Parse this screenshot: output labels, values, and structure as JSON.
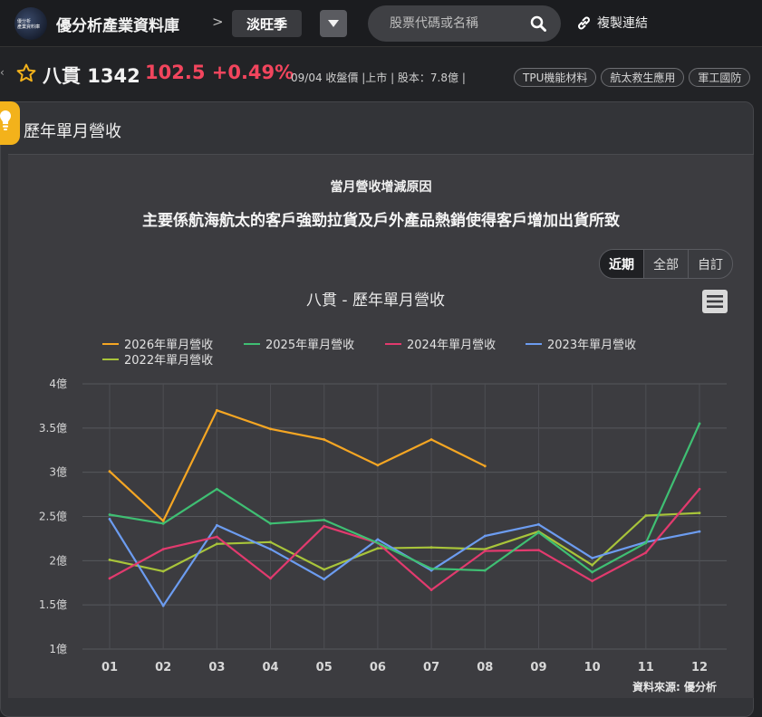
{
  "header": {
    "logo_text_1": "優分析",
    "logo_text_2": "產業資料庫",
    "brand": "優分析產業資料庫",
    "breadcrumb_sep": ">",
    "season_label": "淡旺季",
    "search_placeholder": "股票代碼或名稱",
    "copy_link_label": "複製連結"
  },
  "stock": {
    "name_code": "八貫 1342",
    "price_change": "102.5 +0.49%",
    "meta": "09/04 收盤價 |上市 | 股本：7.8億 |",
    "tags": [
      "TPU機能材料",
      "航太救生應用",
      "軍工國防"
    ]
  },
  "card": {
    "title": "歷年單月營收",
    "reason_title": "當月營收增減原因",
    "reason_text": "主要係航海航太的客戶強勁拉貨及戶外產品熱銷使得客戶增加出貨所致",
    "range_buttons": [
      "近期",
      "全部",
      "自訂"
    ],
    "active_range": "近期",
    "source": "資料來源: 優分析"
  },
  "colors": {
    "2026": "#f5a623",
    "2025": "#3fbf73",
    "2024": "#e23a6e",
    "2023": "#6c9cf0",
    "2022": "#a8c43a"
  },
  "chart_data": {
    "type": "line",
    "title": "八貫 - 歷年單月營收",
    "categories": [
      "01",
      "02",
      "03",
      "04",
      "05",
      "06",
      "07",
      "08",
      "09",
      "10",
      "11",
      "12"
    ],
    "yticks": [
      "4億",
      "3.5億",
      "3億",
      "2.5億",
      "2億",
      "1.5億",
      "1億"
    ],
    "ylim": [
      1,
      4
    ],
    "grid": true,
    "legend_position": "top-left",
    "series": [
      {
        "name": "2026年單月營收",
        "color": "#f5a623",
        "values": [
          3.01,
          2.45,
          3.7,
          3.49,
          3.37,
          3.08,
          3.37,
          3.07,
          null,
          null,
          null,
          null
        ]
      },
      {
        "name": "2025年單月營收",
        "color": "#3fbf73",
        "values": [
          2.52,
          2.42,
          2.81,
          2.42,
          2.46,
          2.2,
          1.91,
          1.89,
          2.32,
          1.87,
          2.2,
          3.55
        ]
      },
      {
        "name": "2024年單月營收",
        "color": "#e23a6e",
        "values": [
          1.8,
          2.13,
          2.27,
          1.8,
          2.39,
          2.2,
          1.67,
          2.11,
          2.12,
          1.77,
          2.09,
          2.81
        ]
      },
      {
        "name": "2023年單月營收",
        "color": "#6c9cf0",
        "values": [
          2.47,
          1.49,
          2.4,
          2.13,
          1.79,
          2.24,
          1.89,
          2.28,
          2.41,
          2.03,
          2.21,
          2.33
        ]
      },
      {
        "name": "2022年單月營收",
        "color": "#a8c43a",
        "values": [
          2.01,
          1.88,
          2.19,
          2.21,
          1.9,
          2.14,
          2.15,
          2.13,
          2.33,
          1.95,
          2.51,
          2.54
        ]
      }
    ]
  }
}
